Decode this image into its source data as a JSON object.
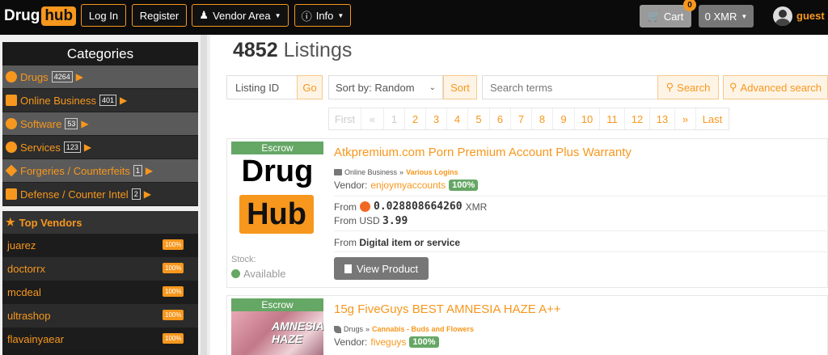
{
  "nav": {
    "logo_a": "Drug",
    "logo_b": "hub",
    "login": "Log In",
    "register": "Register",
    "vendor_area": "Vendor Area",
    "info": "Info",
    "cart": "Cart",
    "cart_count": "0",
    "currency": "0 XMR",
    "user": "guest"
  },
  "sidebar": {
    "categories_title": "Categories",
    "categories": [
      {
        "label": "Drugs",
        "count": "4264"
      },
      {
        "label": "Online Business",
        "count": "401"
      },
      {
        "label": "Software",
        "count": "53"
      },
      {
        "label": "Services",
        "count": "123"
      },
      {
        "label": "Forgeries / Counterfeits",
        "count": "1"
      },
      {
        "label": "Defense / Counter Intel",
        "count": "2"
      }
    ],
    "top_vendors_title": "Top Vendors",
    "vendors": [
      {
        "name": "juarez",
        "pct": "100%"
      },
      {
        "name": "doctorrx",
        "pct": "100%"
      },
      {
        "name": "mcdeal",
        "pct": "100%"
      },
      {
        "name": "ultrashop",
        "pct": "100%"
      },
      {
        "name": "flavainyaear",
        "pct": "100%"
      }
    ]
  },
  "main": {
    "count": "4852",
    "count_label": "Listings",
    "listing_id_placeholder": "Listing ID",
    "go": "Go",
    "sort_by": "Sort by: Random",
    "sort": "Sort",
    "search_placeholder": "Search terms",
    "search": "Search",
    "advanced_search": "Advanced search",
    "pager": [
      "First",
      "«",
      "1",
      "2",
      "3",
      "4",
      "5",
      "6",
      "7",
      "8",
      "9",
      "10",
      "11",
      "12",
      "13",
      "»",
      "Last"
    ]
  },
  "listings": [
    {
      "escrow": "Escrow",
      "thumb_a": "Drug",
      "thumb_b": "Hub",
      "title": "Atkpremium.com Porn Premium Account Plus Warranty",
      "category": "Online Business",
      "subcategory": "Various Logins",
      "vendor_label": "Vendor:",
      "vendor": "enjoymyaccounts",
      "vendor_pct": "100%",
      "from_label": "From",
      "price_xmr": "0.028808664260",
      "xmr_unit": "XMR",
      "usd_label": "From USD",
      "price_usd": "3.99",
      "ship_from": "Digital item or service",
      "stock_label": "Stock:",
      "stock": "Available",
      "view": "View Product"
    },
    {
      "escrow": "Escrow",
      "thumb_text": "AMNESIA HAZE",
      "title": "15g FiveGuys BEST AMNESIA HAZE A++",
      "category": "Drugs",
      "subcategory": "Cannabis - Buds and Flowers",
      "vendor_label": "Vendor:",
      "vendor": "fiveguys",
      "vendor_pct": "100%"
    }
  ],
  "colors": {
    "accent": "#f7971d",
    "nav_bg": "#0b0b0b",
    "success": "#65a765"
  }
}
